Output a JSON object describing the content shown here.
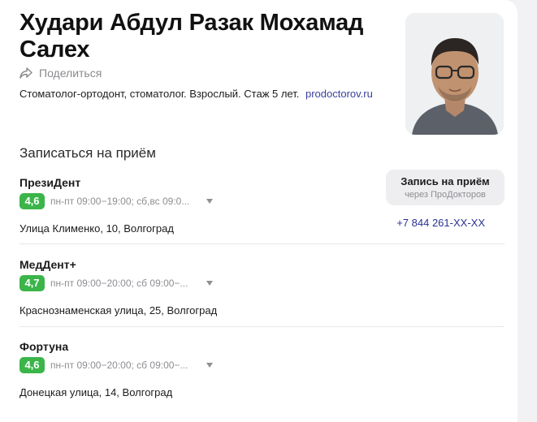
{
  "doctor": {
    "name": "Худари Абдул Разак Мохамад Салех",
    "share_label": "Поделиться",
    "description": "Стоматолог-ортодонт, стоматолог. Взрослый. Стаж 5 лет.",
    "source": "prodoctorov.ru"
  },
  "appointment": {
    "section_title": "Записаться на приём",
    "book_button": {
      "label": "Запись на приём",
      "sublabel": "через ПроДокторов"
    },
    "phone": "+7 844 261-XX-XX",
    "clinics": [
      {
        "name": "ПрезиДент",
        "rating": "4,6",
        "hours": "пн-пт 09:00−19:00; сб,вс 09:0...",
        "address": "Улица Клименко, 10, Волгоград"
      },
      {
        "name": "МедДент+",
        "rating": "4,7",
        "hours": "пн-пт 09:00−20:00; сб 09:00−...",
        "address": "Краснознаменская улица, 25, Волгоград"
      },
      {
        "name": "Фортуна",
        "rating": "4,6",
        "hours": "пн-пт 09:00−20:00; сб 09:00−...",
        "address": "Донецкая улица, 14, Волгоград"
      }
    ]
  },
  "colors": {
    "rating_badge": "#3bb54a",
    "link": "#3b3f9a",
    "phone": "#2a3392"
  },
  "icons": {
    "share": "share-arrow-icon",
    "expand": "chevron-down-icon"
  }
}
